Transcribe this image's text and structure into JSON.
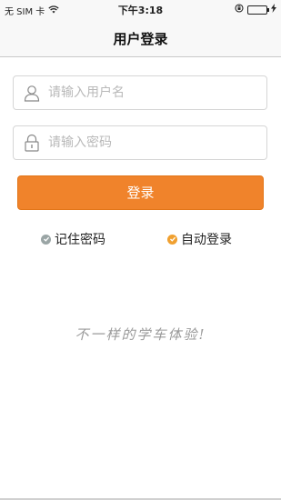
{
  "status_bar": {
    "carrier": "无 SIM 卡",
    "time": "下午3:18"
  },
  "nav": {
    "title": "用户登录"
  },
  "form": {
    "username_placeholder": "请输入用户名",
    "password_placeholder": "请输入密码",
    "login_label": "登录"
  },
  "options": {
    "remember_label": "记住密码",
    "remember_checked": true,
    "remember_color": "#9aa5a5",
    "autologin_label": "自动登录",
    "autologin_checked": true,
    "autologin_color": "#f0a030"
  },
  "slogan": "不一样的学车体验!",
  "colors": {
    "accent": "#f0832b"
  }
}
